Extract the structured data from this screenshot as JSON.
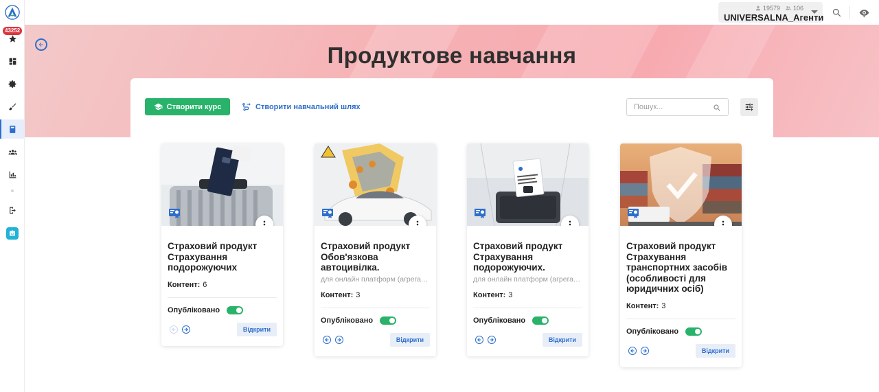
{
  "sidebar": {
    "notification_count": "43252",
    "items": [
      {
        "name": "star-icon"
      },
      {
        "name": "dashboard-icon"
      },
      {
        "name": "gear-icon"
      },
      {
        "name": "brush-icon"
      },
      {
        "name": "book-icon",
        "active": true
      },
      {
        "name": "people-icon"
      },
      {
        "name": "chart-icon"
      },
      {
        "name": "logout-icon"
      },
      {
        "name": "bot-icon"
      }
    ]
  },
  "topbar": {
    "user_count": "19579",
    "group_count": "106",
    "user_name": "UNIVERSALNA_Агенти"
  },
  "page": {
    "title": "Продуктове навчання"
  },
  "toolbar": {
    "create_course_label": "Створити курс",
    "create_path_label": "Створити навчальний шлях",
    "search_placeholder": "Пошук..."
  },
  "cards": [
    {
      "title": "Страховий продукт Страхування подорожуючих",
      "subtitle": "",
      "content_label": "Контент:",
      "content_count": "6",
      "published_label": "Опубліковано",
      "published": true,
      "open_label": "Відкрити"
    },
    {
      "title": "Страховий продукт Обов'язкова автоцивілка.",
      "subtitle": "для онлайн платформ (агрегато...",
      "content_label": "Контент:",
      "content_count": "3",
      "published_label": "Опубліковано",
      "published": true,
      "open_label": "Відкрити"
    },
    {
      "title": "Страховий продукт Страхування подорожуючих.",
      "subtitle": "для онлайн платформ (агрегато...",
      "content_label": "Контент:",
      "content_count": "3",
      "published_label": "Опубліковано",
      "published": true,
      "open_label": "Відкрити"
    },
    {
      "title": "Страховий продукт Страхування транспортних засобів (особливості для юридичних осіб)",
      "subtitle": "",
      "content_label": "Контент:",
      "content_count": "3",
      "published_label": "Опубліковано",
      "published": true,
      "open_label": "Відкрити"
    }
  ],
  "colors": {
    "accent": "#2c6ecb",
    "primary_button": "#29b36a",
    "hero_gradient": "#f7aab0",
    "badge": "#d9353e"
  }
}
